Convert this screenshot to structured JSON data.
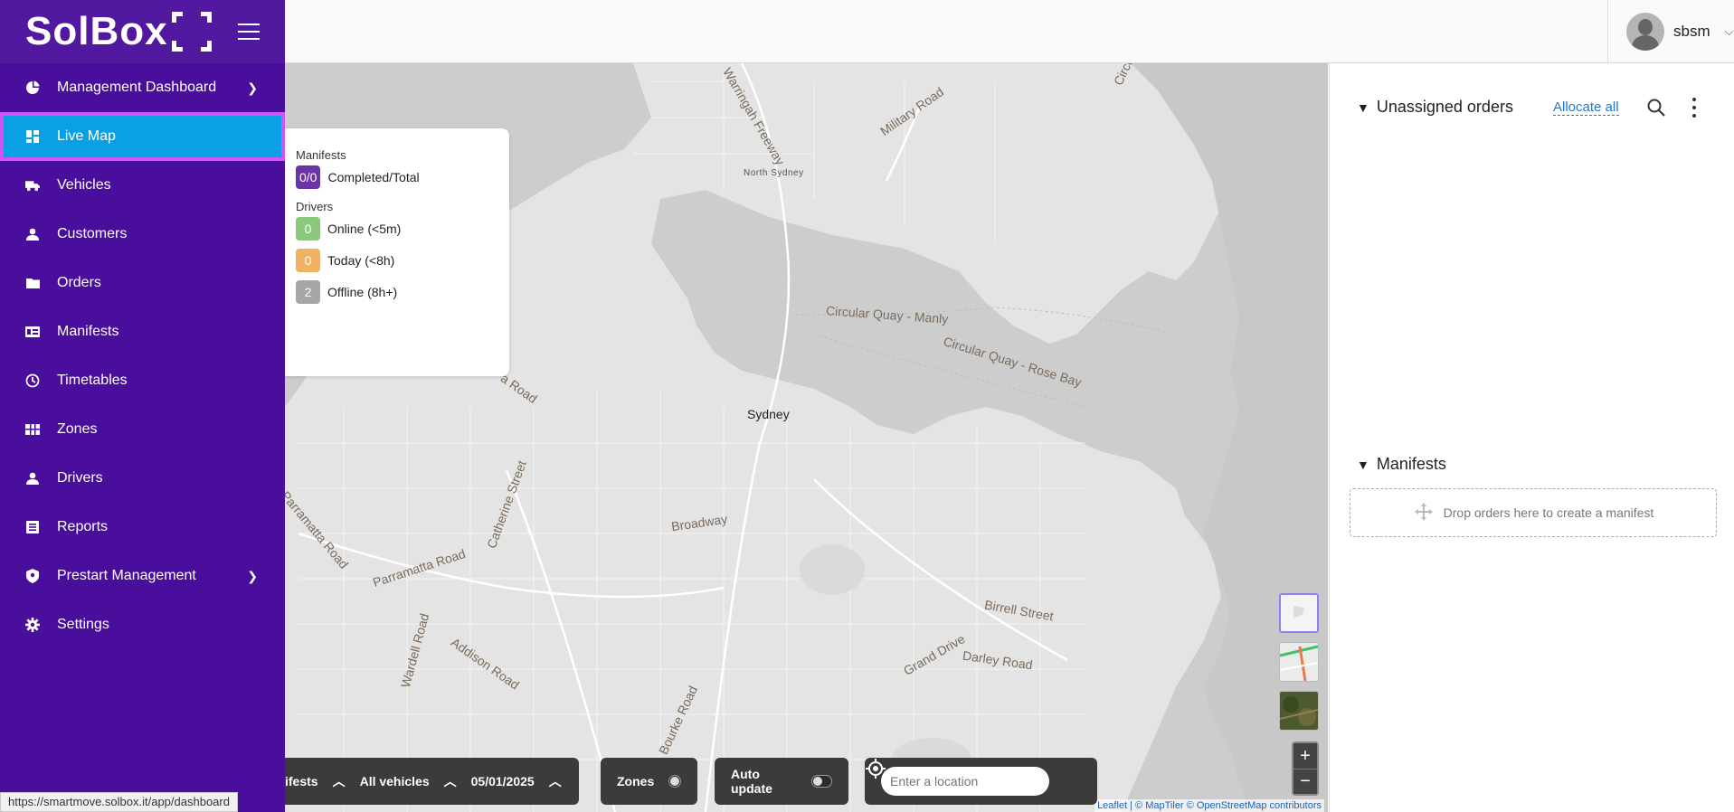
{
  "sidebar": {
    "logo": "SolBox",
    "items": [
      {
        "label": "Management Dashboard",
        "icon": "pie-chart-icon",
        "has_submenu": true
      },
      {
        "label": "Live Map",
        "icon": "dashboard-grid-icon",
        "active": true
      },
      {
        "label": "Vehicles",
        "icon": "truck-icon"
      },
      {
        "label": "Customers",
        "icon": "person-icon"
      },
      {
        "label": "Orders",
        "icon": "folder-icon"
      },
      {
        "label": "Manifests",
        "icon": "manifest-list-icon"
      },
      {
        "label": "Timetables",
        "icon": "clock-icon"
      },
      {
        "label": "Zones",
        "icon": "zones-icon"
      },
      {
        "label": "Drivers",
        "icon": "person-icon"
      },
      {
        "label": "Reports",
        "icon": "report-icon"
      },
      {
        "label": "Prestart Management",
        "icon": "shield-icon",
        "has_submenu": true
      },
      {
        "label": "Settings",
        "icon": "gear-icon"
      }
    ],
    "active_color": "#0aa0e4",
    "bg_color": "#4a0e9c"
  },
  "header": {
    "username": "sbsm"
  },
  "legend": {
    "manifests_title": "Manifests",
    "manifests_badge": "0/0",
    "manifests_label": "Completed/Total",
    "drivers_title": "Drivers",
    "online_count": "0",
    "online_label": "Online (<5m)",
    "today_count": "0",
    "today_label": "Today (<8h)",
    "offline_count": "2",
    "offline_label": "Offline (8h+)"
  },
  "map": {
    "labels": {
      "sydney": "Sydney",
      "north_sydney": "North Sydney",
      "circular_quay_manly": "Circular Quay - Manly",
      "circular_quay_rose_bay": "Circular Quay - Rose Bay",
      "circular_quay_manly_2": "Circular Quay - Man",
      "broadway": "Broadway",
      "parramatta_road": "Parramatta Road",
      "parramatta_road_2": "Parramatta Road",
      "catherine_street": "Catherine Street",
      "addison_road": "Addison Road",
      "wardell_road": "Wardell Road",
      "military_road": "Military Road",
      "warringah_freeway": "Warringah Freeway",
      "birrell_street": "Birrell Street",
      "darley_road": "Darley Road",
      "grand_drive": "Grand Drive",
      "bourke_road": "Bourke Road",
      "road_fragment": "a Road"
    },
    "attribution": "Leaflet | © MapTiler © OpenStreetMap contributors",
    "zoom_in": "+",
    "zoom_out": "−"
  },
  "controls": {
    "manifests_filter": "ifests",
    "vehicles_filter": "All vehicles",
    "date": "05/01/2025",
    "zones_label": "Zones",
    "auto_update_label": "Auto update",
    "location_placeholder": "Enter a location"
  },
  "panel": {
    "unassigned_title": "Unassigned orders",
    "allocate_all": "Allocate all",
    "manifests_title": "Manifests",
    "drop_text": "Drop orders here to create a manifest"
  },
  "status_url": "https://smartmove.solbox.it/app/dashboard"
}
